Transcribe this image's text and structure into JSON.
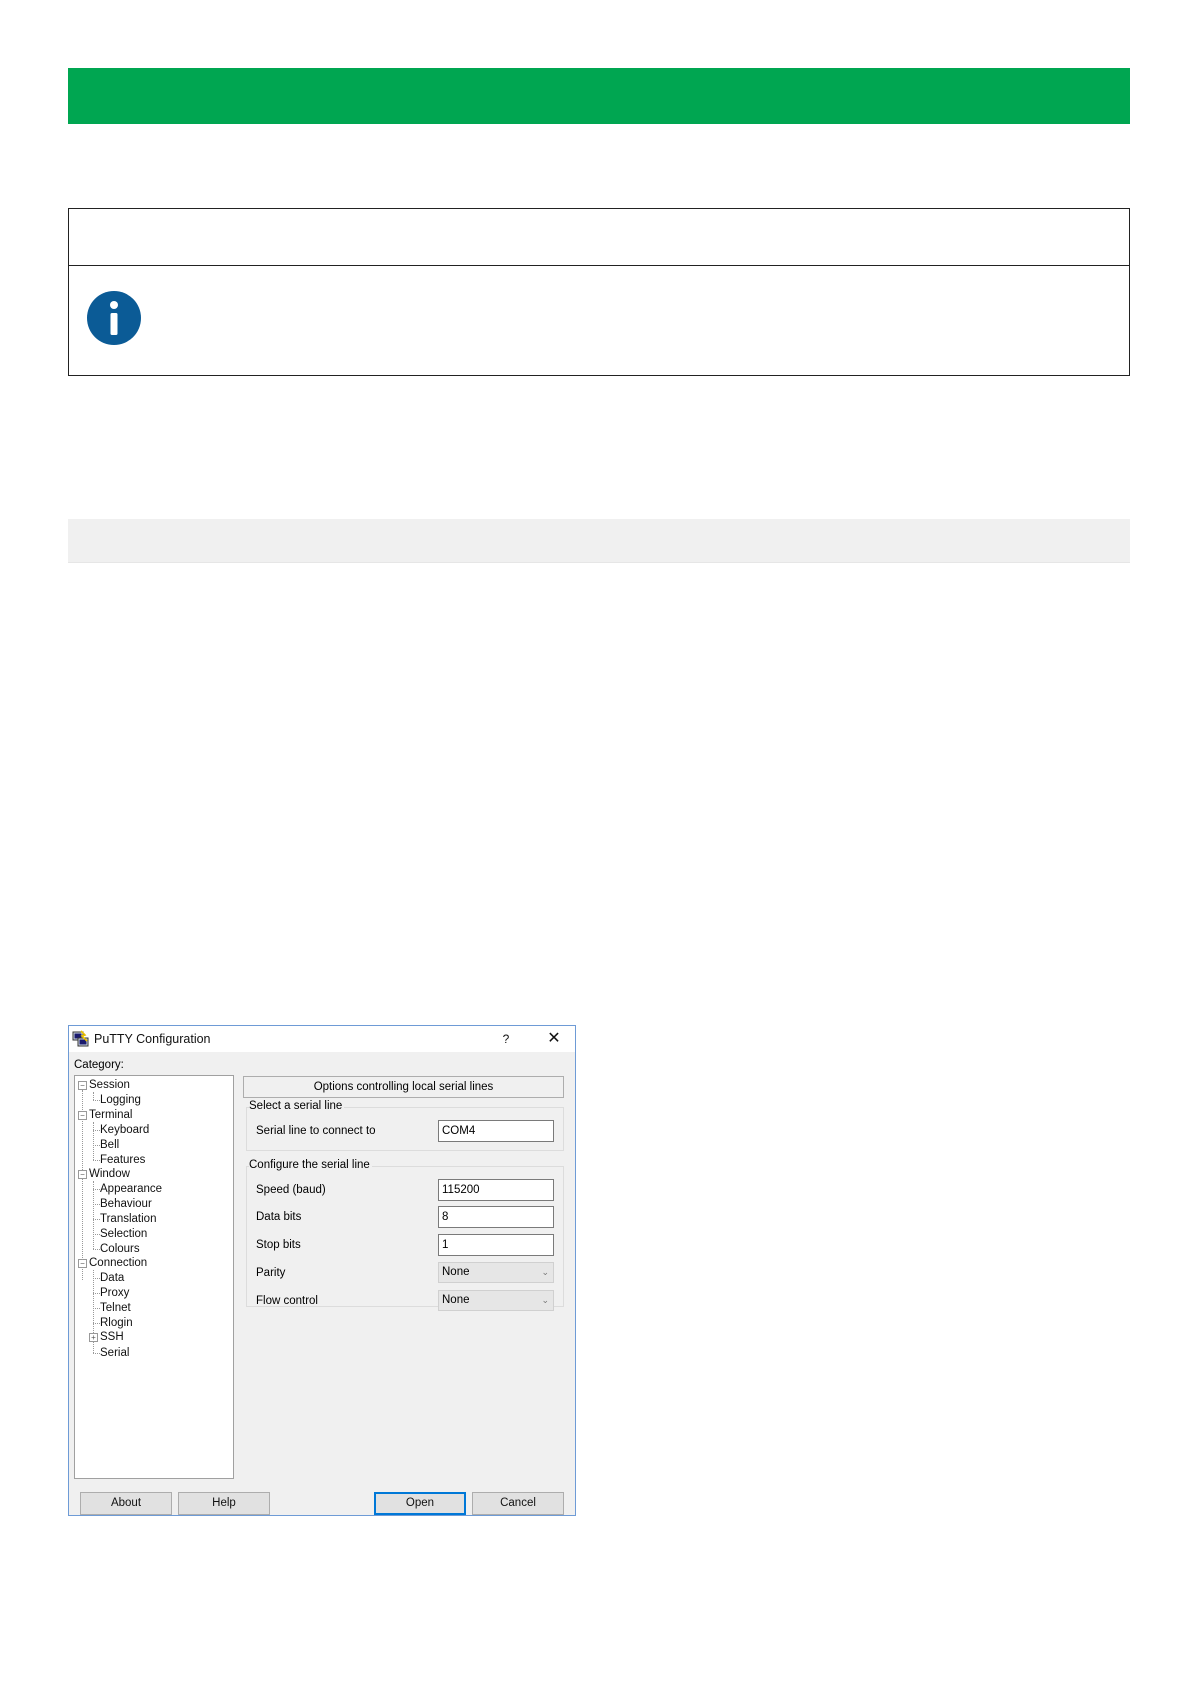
{
  "window": {
    "title": "PuTTY Configuration",
    "help_label": "?",
    "close_label": "✕"
  },
  "category_label": "Category:",
  "tree": {
    "nodes": [
      "Session",
      "Logging",
      "Terminal",
      "Keyboard",
      "Bell",
      "Features",
      "Window",
      "Appearance",
      "Behaviour",
      "Translation",
      "Selection",
      "Colours",
      "Connection",
      "Data",
      "Proxy",
      "Telnet",
      "Rlogin",
      "SSH",
      "Serial"
    ],
    "expander_collapse": "−",
    "expander_expand": "+"
  },
  "panel": {
    "header": "Options controlling local serial lines",
    "group1_title": "Select a serial line",
    "serial_line_label": "Serial line to connect to",
    "serial_line_value": "COM4",
    "group2_title": "Configure the serial line",
    "speed_label": "Speed (baud)",
    "speed_value": "115200",
    "data_bits_label": "Data bits",
    "data_bits_value": "8",
    "stop_bits_label": "Stop bits",
    "stop_bits_value": "1",
    "parity_label": "Parity",
    "parity_value": "None",
    "flow_label": "Flow control",
    "flow_value": "None",
    "select_arrow": "⌄"
  },
  "buttons": {
    "about": "About",
    "help": "Help",
    "open": "Open",
    "cancel": "Cancel"
  },
  "colors": {
    "header_bar": "#00a651",
    "info_icon": "#0b5b96",
    "window_border": "#6e9bd6",
    "default_button_border": "#0078d7"
  }
}
